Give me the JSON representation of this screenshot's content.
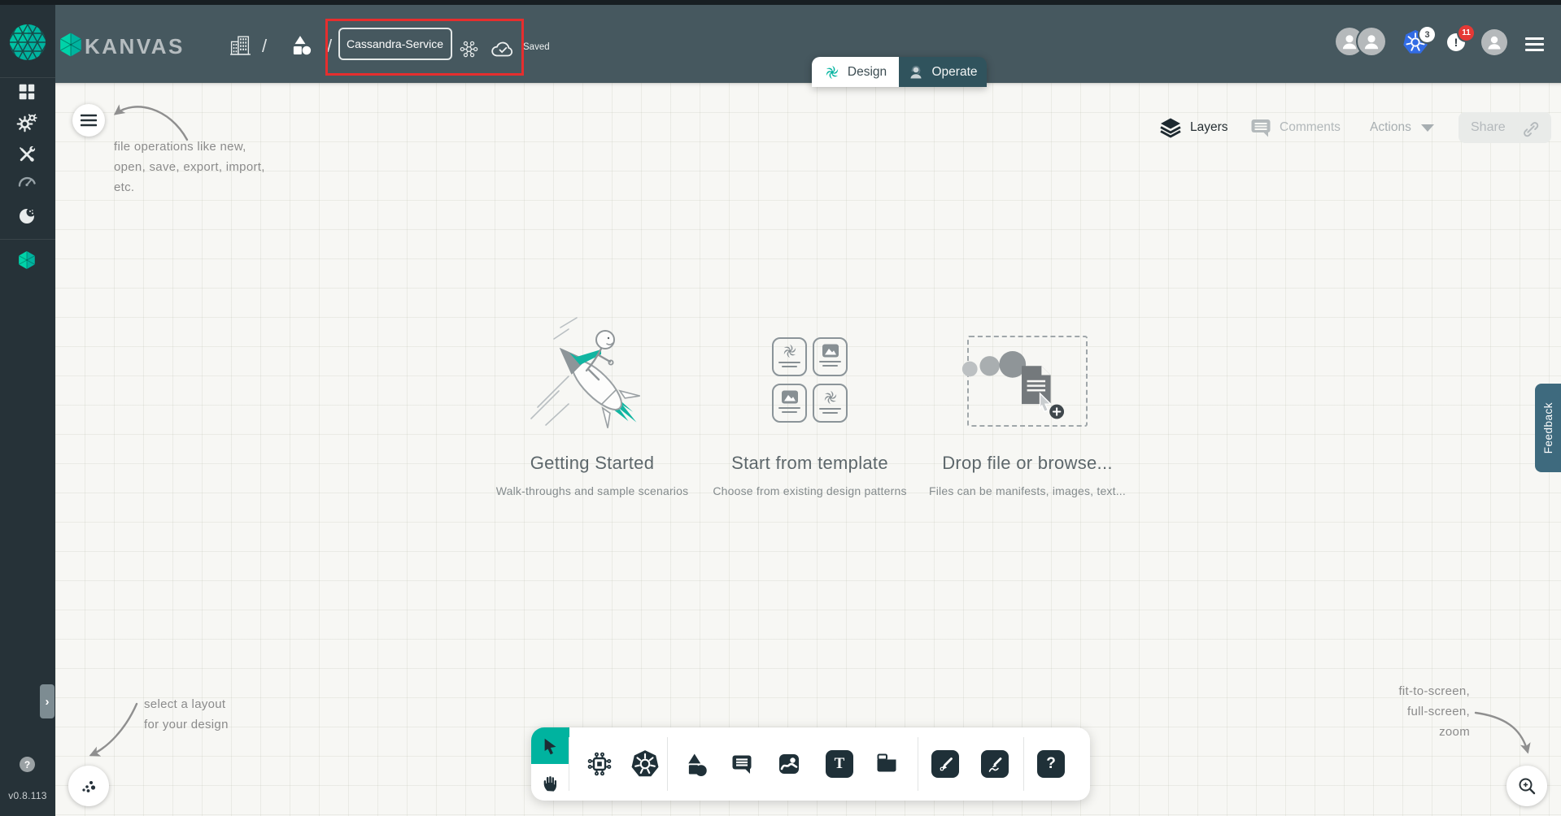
{
  "app": {
    "brand": "KANVAS",
    "version": "v0.8.113"
  },
  "header": {
    "file_name": "Cassandra-Service",
    "saved_status": "Saved",
    "separator": "/",
    "tabs": [
      {
        "label": "Design"
      },
      {
        "label": "Operate"
      }
    ],
    "kubernetes_badge": "3",
    "notification_badge": "11",
    "alert_glyph": "!"
  },
  "canvas_controls": {
    "layers": "Layers",
    "comments": "Comments",
    "actions": "Actions",
    "share": "Share"
  },
  "panels": [
    {
      "title": "Getting Started",
      "subtitle": "Walk-throughs and sample scenarios"
    },
    {
      "title": "Start from template",
      "subtitle": "Choose from existing design patterns"
    },
    {
      "title": "Drop file or browse...",
      "subtitle": "Files can be manifests, images, text..."
    }
  ],
  "annotations": {
    "file_ops": {
      "line1": "file operations like new,",
      "line2": "open, save, export, import,",
      "line3": "etc."
    },
    "layout": {
      "line1": "select a layout",
      "line2": "for your design"
    },
    "zoom": {
      "line1": "fit-to-screen,",
      "line2": "full-screen,",
      "line3": "zoom"
    }
  },
  "feedback_tab": "Feedback",
  "glyphs": {
    "help": "?",
    "expand": "›",
    "text_tool": "T"
  },
  "icons": {
    "sidebar": [
      "dashboard-icon",
      "lifecycle-gears-icon",
      "configuration-tools-icon",
      "performance-gauge-icon",
      "extensions-icon",
      "kanvas-hexagon-icon"
    ],
    "toolbar": [
      "cursor-tool",
      "pan-hand-tool",
      "integration-chip-tool",
      "kubernetes-tool",
      "shapes-tool",
      "comment-tool",
      "image-tool",
      "text-tool",
      "section-tool",
      "pen-tool",
      "pencil-tool",
      "help-tool"
    ]
  },
  "colors": {
    "accent_teal": "#00b39f",
    "accent_teal_light": "#00d3a9",
    "header_bg": "#46585f",
    "sidebar_bg": "#263238",
    "kubernetes_blue": "#326ce5",
    "notification_red": "#e53935",
    "annotation_highlight_red": "#e62e2e",
    "feedback_bg": "#3e6a7e",
    "canvas_bg": "#f7f7f4"
  }
}
